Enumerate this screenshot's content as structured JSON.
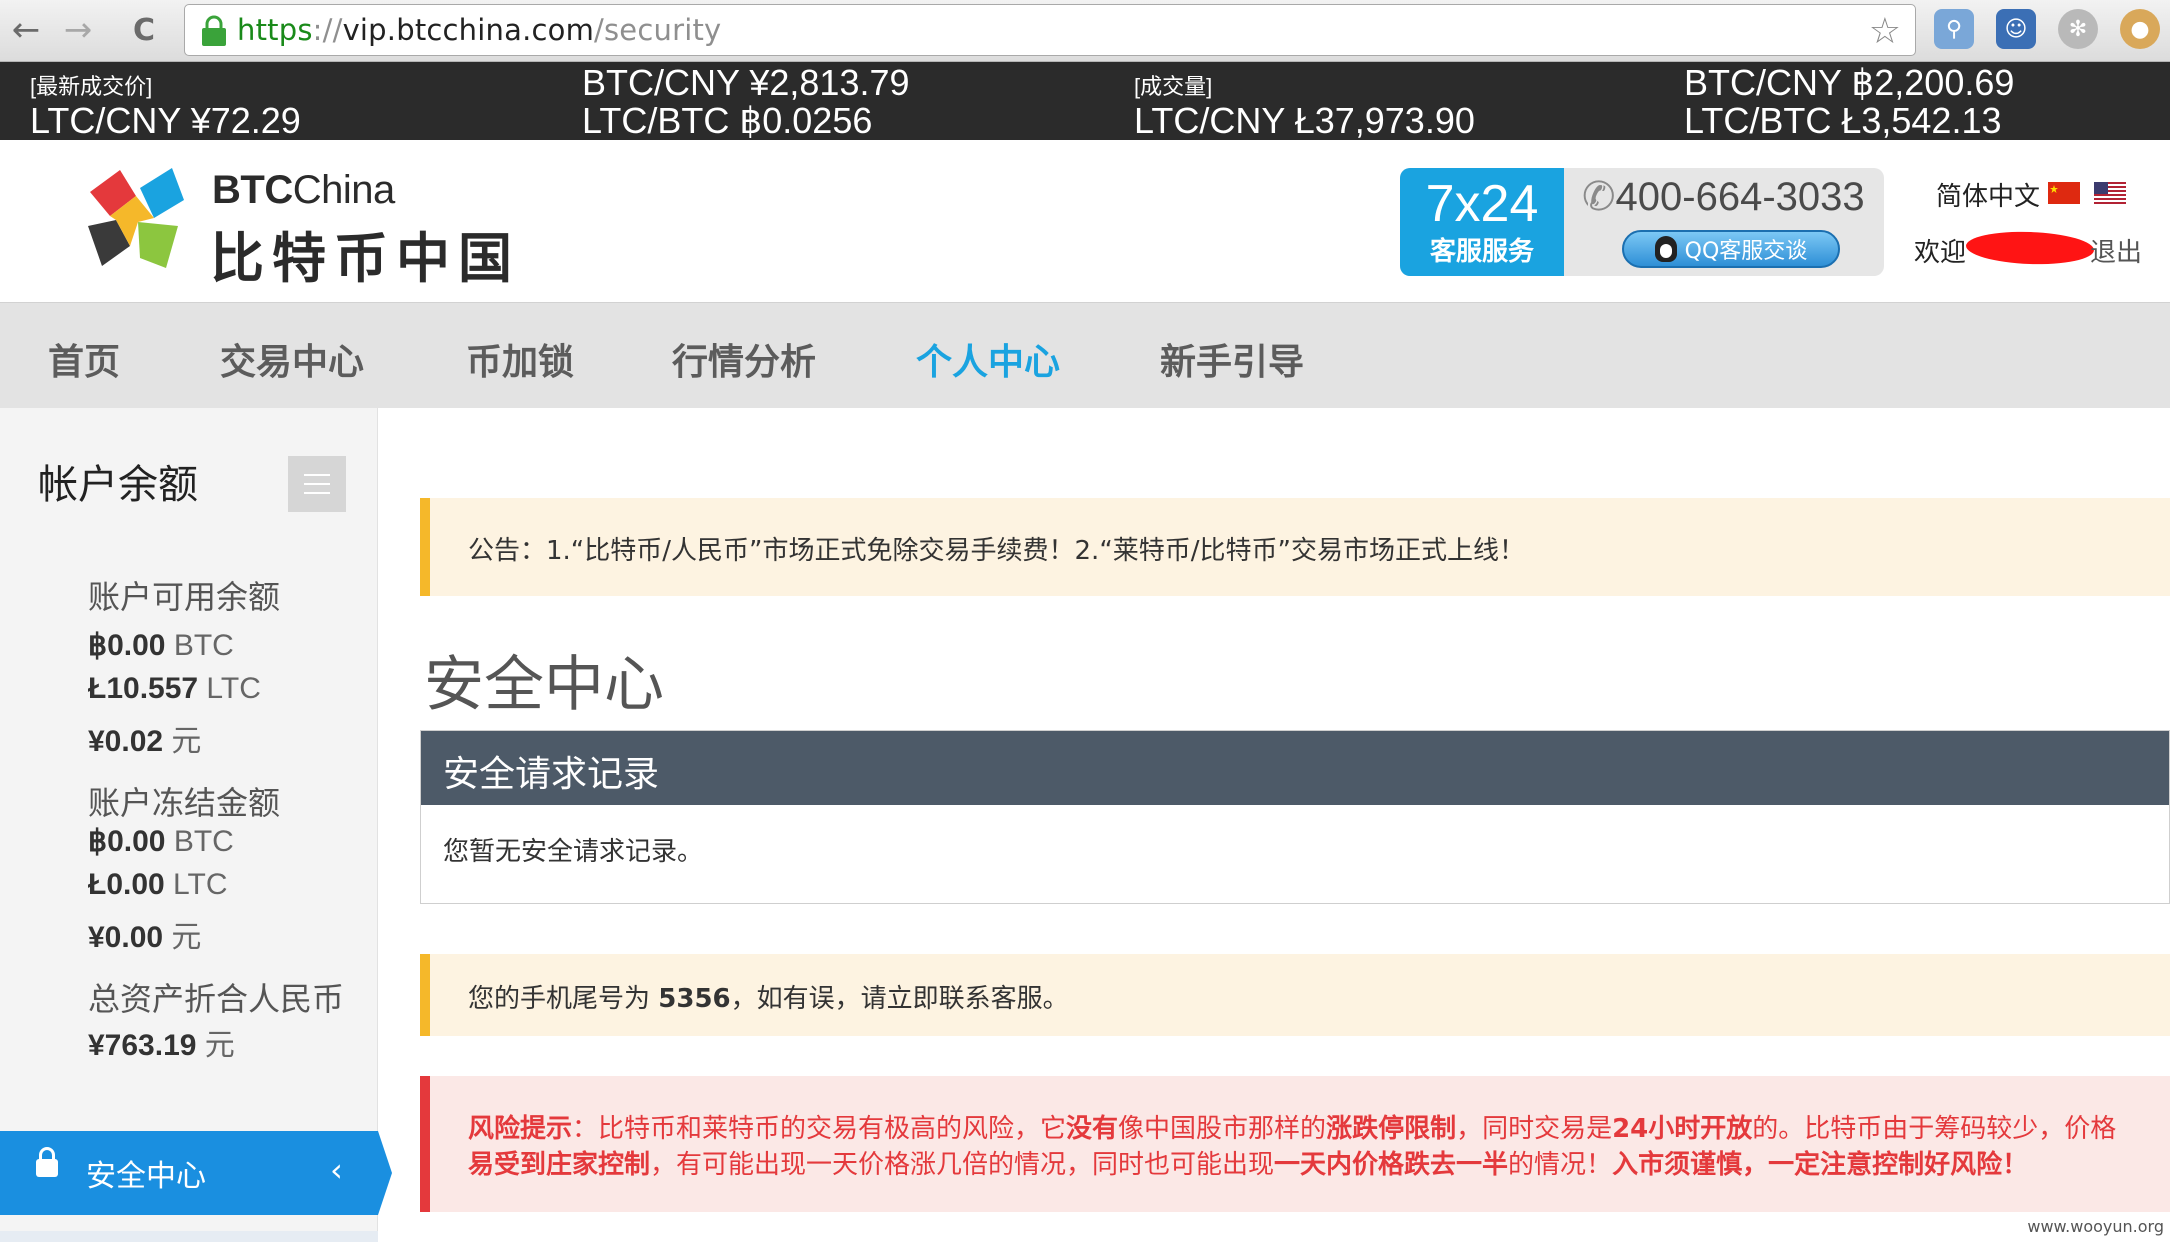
{
  "browser": {
    "url_scheme": "https",
    "url_sep": "://",
    "url_host": "vip.btcchina.com",
    "url_path": "/security",
    "back_icon": "←",
    "forward_icon": "→",
    "reload_icon": "C",
    "star_icon": "☆"
  },
  "ticker": {
    "col1_label": "[最新成交价]",
    "col1_value": "LTC/CNY ¥72.29",
    "col2_line1": "BTC/CNY ¥2,813.79",
    "col2_line2": "LTC/BTC ฿0.0256",
    "col3_label": "[成交量]",
    "col3_value": "LTC/CNY Ł37,973.90",
    "col4_line1": "BTC/CNY ฿2,200.69",
    "col4_line2": "LTC/BTC Ł3,542.13"
  },
  "header": {
    "brand_en_bold": "BTC",
    "brand_en": "China",
    "brand_cn": "比特币中国",
    "service_big": "7x24",
    "service_small": "客服服务",
    "phone": "400-664-3033",
    "qq_label": "QQ客服交谈",
    "language": "简体中文",
    "welcome": "欢迎",
    "logout": "退出"
  },
  "nav": {
    "items": [
      "首页",
      "交易中心",
      "币加锁",
      "行情分析",
      "个人中心",
      "新手引导"
    ],
    "active": "个人中心"
  },
  "sidebar": {
    "title": "帐户余额",
    "available_label": "账户可用余额",
    "available": [
      {
        "amount": "฿0.00",
        "unit": " BTC"
      },
      {
        "amount": "Ł10.557",
        "unit": " LTC"
      },
      {
        "amount": "¥0.02",
        "unit": " 元"
      }
    ],
    "frozen_label": "账户冻结金额",
    "frozen": [
      {
        "amount": "฿0.00",
        "unit": " BTC"
      },
      {
        "amount": "Ł0.00",
        "unit": " LTC"
      },
      {
        "amount": "¥0.00",
        "unit": " 元"
      }
    ],
    "total_label": "总资产折合人民币",
    "total": {
      "amount": "¥763.19",
      "unit": " 元"
    },
    "active_item": "安全中心",
    "active_chevron": "‹"
  },
  "content": {
    "announcement": "公告：1.“比特币/人民币”市场正式免除交易手续费！2.“莱特币/比特币”交易市场正式上线！",
    "page_title": "安全中心",
    "panel_title": "安全请求记录",
    "panel_empty": "您暂无安全请求记录。",
    "phone_notice_prefix": "您的手机尾号为 ",
    "phone_tail": "5356",
    "phone_notice_suffix": "，如有误，请立即联系客服。",
    "risk": {
      "label": "风险提示",
      "p1": "：比特币和莱特币的交易有极高的风险，它",
      "b1": "没有",
      "p2": "像中国股市那样的",
      "b2": "涨跌停限制",
      "p3": "，同时交易是",
      "b3": "24小时开放",
      "p4": "的。比特币由于筹码较少，价格",
      "b4": "易受到庄家控制",
      "p5": "，有可能出现一天价格涨几倍的情况，同时也可能出现",
      "b5": "一天内价格跌去一半",
      "p6": "的情况！",
      "b6": "入市须谨慎，一定注意控制好风险！"
    }
  },
  "watermark": "www.wooyun.org",
  "colors": {
    "accent_blue": "#1aa3e0",
    "sidebar_active": "#1a8fe0",
    "notice_border": "#f5b82a",
    "risk_red": "#e4393c",
    "panel_header": "#4d5a68"
  }
}
